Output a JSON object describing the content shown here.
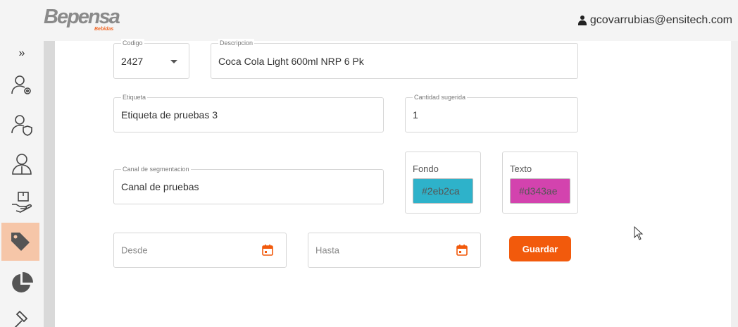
{
  "header": {
    "logo_text": "Bepensa",
    "logo_sub": "Bebidas",
    "user_email": "gcovarrubias@ensitech.com"
  },
  "sidebar": {
    "expand_glyph": "»",
    "items": [
      {
        "icon": "user-settings-icon"
      },
      {
        "icon": "user-shield-icon"
      },
      {
        "icon": "users-icon"
      },
      {
        "icon": "hand-box-icon"
      },
      {
        "icon": "tag-icon",
        "active": true
      },
      {
        "icon": "pie-chart-icon"
      },
      {
        "icon": "gavel-icon"
      }
    ]
  },
  "form": {
    "codigo": {
      "label": "Codigo",
      "value": "2427"
    },
    "descripcion": {
      "label": "Descripcion",
      "value": "Coca Cola Light 600ml NRP 6 Pk"
    },
    "etiqueta": {
      "label": "Etiqueta",
      "value": "Etiqueta de pruebas 3"
    },
    "cantidad": {
      "label": "Cantidad sugerida",
      "value": "1"
    },
    "canal": {
      "label": "Canal de segmentacion",
      "value": "Canal de pruebas"
    },
    "fondo": {
      "label": "Fondo",
      "value": "#2eb2ca",
      "color": "#2eb2ca"
    },
    "texto": {
      "label": "Texto",
      "value": "#d343ae",
      "color": "#d343ae"
    },
    "desde": {
      "placeholder": "Desde"
    },
    "hasta": {
      "placeholder": "Hasta"
    },
    "save_label": "Guardar"
  },
  "colors": {
    "accent": "#f25a0c",
    "active_nav": "#f6c6a8"
  }
}
